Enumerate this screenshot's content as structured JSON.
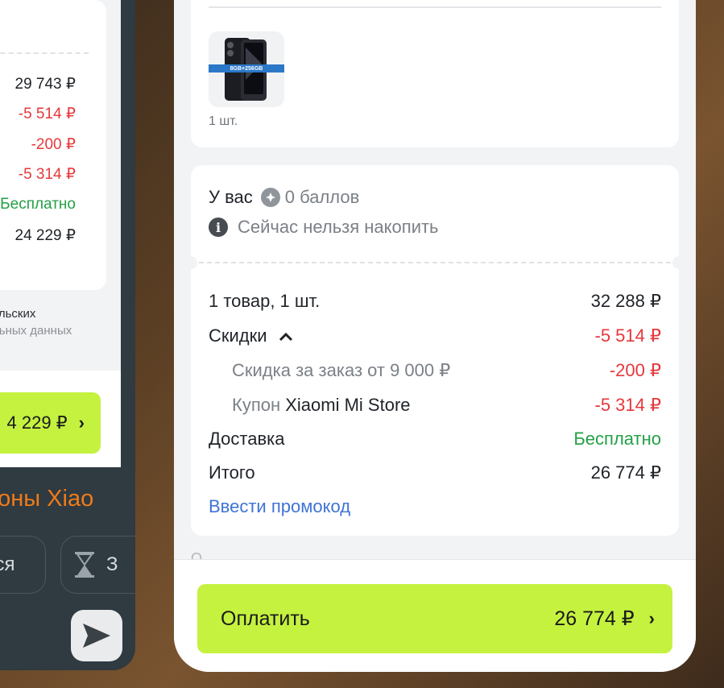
{
  "background_app": {
    "summary_values": [
      "29 743 ₽",
      "-5 514 ₽",
      "-200 ₽",
      "-5 314 ₽",
      "Бесплатно",
      "24 229 ₽"
    ],
    "note_line1": "ельских",
    "note_line2": "льных данных",
    "pay_amount": "4 229 ₽",
    "pay_chevron": "›",
    "title": "тфоны Xiao",
    "chip1_label": "ься",
    "chip2_label": "З",
    "chip2_icon": "hourglass-icon",
    "send_icon": "send-icon"
  },
  "order": {
    "item_badge": "8GB+256GB",
    "item_qty": "1 шт.",
    "points": {
      "prefix": "У вас",
      "value": "0 баллов",
      "info": "Сейчас нельзя накопить"
    },
    "summary": {
      "items_label": "1 товар, 1 шт.",
      "items_value": "32 288 ₽",
      "discounts_label": "Скидки",
      "discounts_value": "-5 514 ₽",
      "order_discount_label": "Скидка за заказ от 9 000 ₽",
      "order_discount_value": "-200 ₽",
      "coupon_prefix": "Купон",
      "coupon_name": "Xiaomi Mi Store",
      "coupon_value": "-5 314 ₽",
      "delivery_label": "Доставка",
      "delivery_value": "Бесплатно",
      "total_label": "Итого",
      "total_value": "26 774 ₽"
    },
    "promo_link": "Ввести промокод",
    "partial_text": "О"
  },
  "pay_button": {
    "label": "Оплатить",
    "amount": "26 774 ₽",
    "chevron": "›"
  },
  "colors": {
    "accent_green": "#c5f23f",
    "discount_red": "#e5383b",
    "free_green": "#23a047",
    "link_blue": "#3f73d6",
    "title_orange": "#ef7b18"
  }
}
